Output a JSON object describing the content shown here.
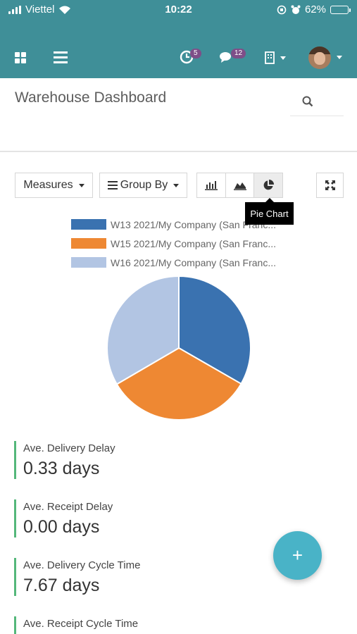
{
  "status_bar": {
    "carrier": "Viettel",
    "time": "10:22",
    "battery": "62%",
    "battery_level": 0.62
  },
  "nav": {
    "activity_badge": "5",
    "messages_badge": "12"
  },
  "header": {
    "title": "Warehouse Dashboard"
  },
  "toolbar": {
    "measures_label": "Measures",
    "group_by_label": "Group By",
    "tooltip": "Pie Chart"
  },
  "chart_data": {
    "type": "pie",
    "series": [
      {
        "name": "W13 2021/My Company (San Franc...",
        "value": 33.3,
        "color": "#3a72b0"
      },
      {
        "name": "W15 2021/My Company (San Franc...",
        "value": 33.3,
        "color": "#ee8833"
      },
      {
        "name": "W16 2021/My Company (San Franc...",
        "value": 33.4,
        "color": "#b2c5e3"
      }
    ],
    "legend": "top"
  },
  "kpis": [
    {
      "label": "Ave. Delivery Delay",
      "value": "0.33 days"
    },
    {
      "label": "Ave. Receipt Delay",
      "value": "0.00 days"
    },
    {
      "label": "Ave. Delivery Cycle Time",
      "value": "7.67 days"
    },
    {
      "label": "Ave. Receipt Cycle Time",
      "value": ""
    }
  ],
  "fab": {
    "label": "+"
  },
  "colors": {
    "brand": "#3f8f98",
    "badge": "#7e4e88",
    "kpi_border": "#54b77a",
    "fab": "#49b3c7"
  }
}
